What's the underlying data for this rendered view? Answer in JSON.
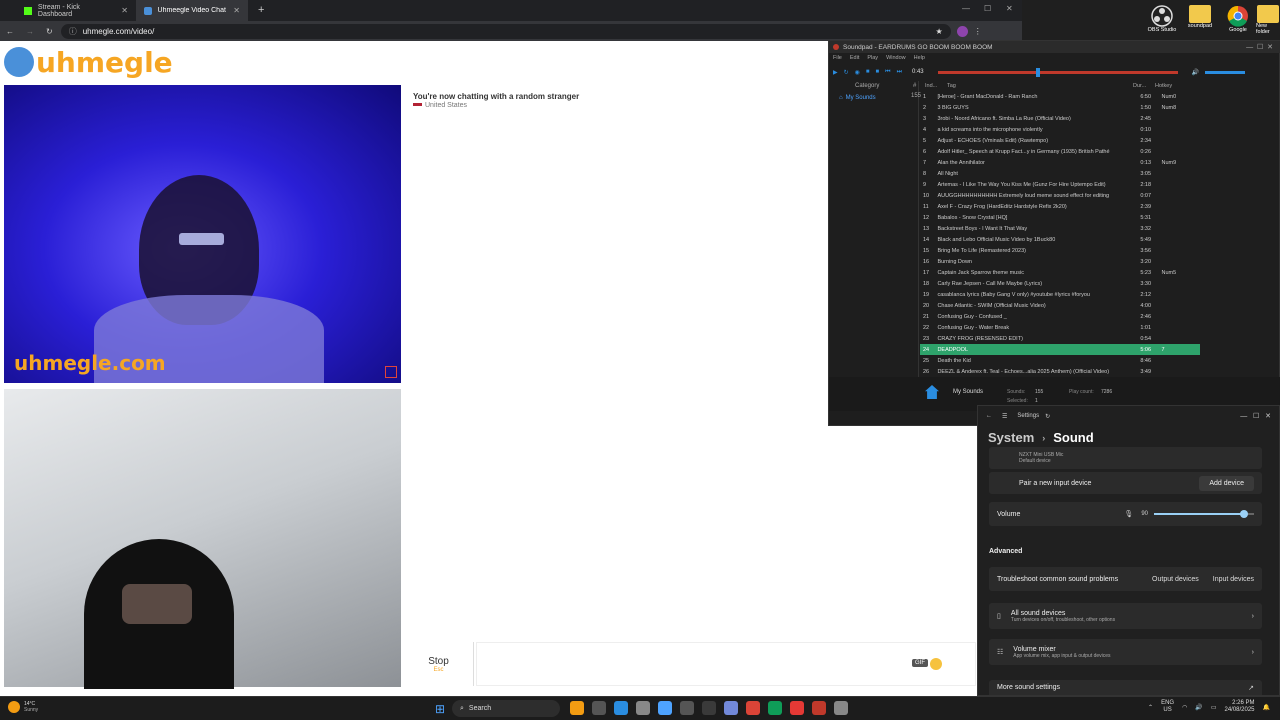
{
  "browser": {
    "tabs": [
      {
        "label": "Stream - Kick Dashboard"
      },
      {
        "label": "Uhmeegle Video Chat | Onl"
      }
    ],
    "address": "uhmegle.com/video/"
  },
  "uhmegle": {
    "logo": "uhmegle",
    "watermark": "uhmegle.com",
    "status": "You're now chatting with a random stranger",
    "country": "United States",
    "stop_label": "Stop",
    "stop_hint": "Esc",
    "gif_label": "GIF"
  },
  "desktop_icons": [
    "OBS Studio",
    "soundpad",
    "Google",
    "New folder"
  ],
  "soundpad": {
    "title": "Soundpad - EARDRUMS GO BOOM BOOM BOOM",
    "menu": [
      "File",
      "Edit",
      "Play",
      "Window",
      "Help"
    ],
    "time": "0:43",
    "columns": {
      "category": "Category",
      "index": "#",
      "ind": "Ind...",
      "tag": "Tag",
      "dur": "Dur...",
      "hotkey": "Hotkey"
    },
    "category_name": "My Sounds",
    "category_count": "155",
    "rows": [
      {
        "n": "1",
        "tag": "[Heroe] - Grant MacDonald - Ram Ranch",
        "dur": "6:50",
        "hk": "Num0"
      },
      {
        "n": "2",
        "tag": "3 BIG GUYS",
        "dur": "1:50",
        "hk": "Num8"
      },
      {
        "n": "3",
        "tag": "3robi - Noord Africano ft. Simba La Rue (Official Video)",
        "dur": "2:45",
        "hk": ""
      },
      {
        "n": "4",
        "tag": "a kid screams into the microphone violently",
        "dur": "0:10",
        "hk": ""
      },
      {
        "n": "5",
        "tag": "Adjust - ECHOES (Vminals Edit) (Rawtempo)",
        "dur": "2:34",
        "hk": ""
      },
      {
        "n": "6",
        "tag": "Adolf Hitler_ Speech at Krupp Fact...y in Germany (1935)  British Pathé",
        "dur": "0:26",
        "hk": ""
      },
      {
        "n": "7",
        "tag": "Alan the Annihilator",
        "dur": "0:13",
        "hk": "Num9"
      },
      {
        "n": "8",
        "tag": "All Night",
        "dur": "3:05",
        "hk": ""
      },
      {
        "n": "9",
        "tag": "Artemas - I Like The Way You Kiss Me (Gunz For Hire Uptempo Edit)",
        "dur": "2:18",
        "hk": ""
      },
      {
        "n": "10",
        "tag": "AUUGGHHHHHHHHHH Extremely loud meme sound effect for editing",
        "dur": "0:07",
        "hk": ""
      },
      {
        "n": "11",
        "tag": "Axel F - Crazy Frog (HardEditz Hardstyle Refix 2k20)",
        "dur": "2:39",
        "hk": ""
      },
      {
        "n": "12",
        "tag": "Babalos - Snow Crystal [HQ]",
        "dur": "5:31",
        "hk": ""
      },
      {
        "n": "13",
        "tag": "Backstreet Boys - I Want It That Way",
        "dur": "3:32",
        "hk": ""
      },
      {
        "n": "14",
        "tag": "Black and Lebo Official Music Video by 1Buck80",
        "dur": "5:49",
        "hk": ""
      },
      {
        "n": "15",
        "tag": "Bring Me To Life (Remastered 2023)",
        "dur": "3:56",
        "hk": ""
      },
      {
        "n": "16",
        "tag": "Burning Down",
        "dur": "3:20",
        "hk": ""
      },
      {
        "n": "17",
        "tag": "Captain Jack Sparrow theme music",
        "dur": "5:23",
        "hk": "Num5"
      },
      {
        "n": "18",
        "tag": "Carly Rae Jepsen - Call Me Maybe (Lyrics)",
        "dur": "3:30",
        "hk": ""
      },
      {
        "n": "19",
        "tag": "casablanca lyrics (Baby Gang V only) #youtube #lyrics #foryou",
        "dur": "2:12",
        "hk": ""
      },
      {
        "n": "20",
        "tag": "Chase Atlantic - SWIM (Official Music Video)",
        "dur": "4:00",
        "hk": ""
      },
      {
        "n": "21",
        "tag": "Confusing Guy - Confused _",
        "dur": "2:46",
        "hk": ""
      },
      {
        "n": "22",
        "tag": "Confusing Guy - Water Break",
        "dur": "1:01",
        "hk": ""
      },
      {
        "n": "23",
        "tag": "CRAZY FROG (RESENSED EDIT)",
        "dur": "0:54",
        "hk": ""
      },
      {
        "n": "24",
        "tag": "DEADPOOL",
        "dur": "5:06",
        "hk": "7"
      },
      {
        "n": "25",
        "tag": "Death the Kid",
        "dur": "8:46",
        "hk": ""
      },
      {
        "n": "26",
        "tag": "DEEZL & Anderex ft. Teal - Echoes...alia 2025 Anthem) (Official Video)",
        "dur": "3:49",
        "hk": ""
      }
    ],
    "selected_index": 23,
    "footer": {
      "name": "My Sounds",
      "sounds_label": "Sounds:",
      "sounds": "155",
      "playcount_label": "Play count:",
      "playcount": "7286",
      "selected_label": "Selected:",
      "selected": "1"
    }
  },
  "settings": {
    "window_title": "Settings",
    "breadcrumb_parent": "System",
    "breadcrumb_current": "Sound",
    "device_name": "NZXT Mini USB Mic",
    "device_sub": "Default device",
    "pair_label": "Pair a new input device",
    "add_device": "Add device",
    "volume_label": "Volume",
    "volume_value": "90",
    "volume_level": 0.9,
    "advanced_label": "Advanced",
    "troubleshoot_label": "Troubleshoot common sound problems",
    "output_devices": "Output devices",
    "input_devices": "Input devices",
    "all_devices_title": "All sound devices",
    "all_devices_sub": "Turn devices on/off, troubleshoot, other options",
    "mixer_title": "Volume mixer",
    "mixer_sub": "App volume mix, app input & output devices",
    "more_settings": "More sound settings"
  },
  "taskbar": {
    "weather_temp": "14°C",
    "weather_desc": "Sunny",
    "search": "Search",
    "lang": "ENG",
    "region": "US",
    "time": "2:26 PM",
    "date": "24/08/2025"
  },
  "colors": {
    "accent": "#2ea36b",
    "uhmegle_orange": "#f6a623",
    "soundpad_red": "#c0392b"
  }
}
